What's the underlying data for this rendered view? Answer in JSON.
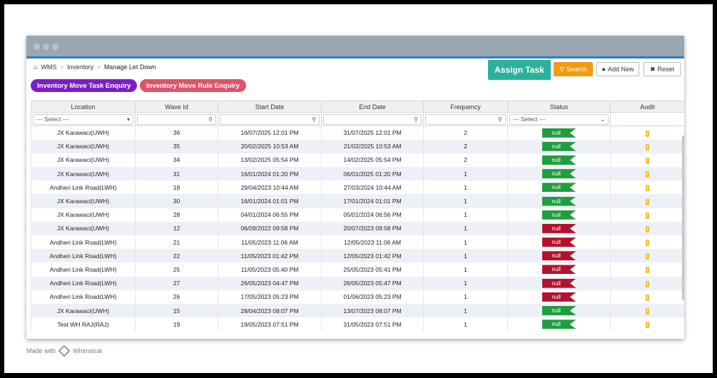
{
  "breadcrumb": {
    "root": "WMS",
    "section": "Inventory",
    "current": "Manage Let Down"
  },
  "tabs": {
    "move_task": "Inventory Move Task Enquiry",
    "move_rule": "Inventory Move Rule Enquiry"
  },
  "buttons": {
    "assign_task": "Assign Task",
    "search": "Search",
    "add_new": "Add New",
    "reset": "Reset"
  },
  "columns": [
    "Location",
    "Wave Id",
    "Start Date",
    "End Date",
    "Frequency",
    "Status",
    "Audit"
  ],
  "filters": {
    "location_select": "--- Select ---",
    "status_select": "--- Select ---"
  },
  "rows": [
    {
      "location": "JX Karawaci(UWH)",
      "wave": "36",
      "start": "16/07/2025 12:01 PM",
      "end": "31/07/2025 12:01 PM",
      "freq": "2",
      "status": "null",
      "color": "green"
    },
    {
      "location": "JX Karawaci(UWH)",
      "wave": "35",
      "start": "20/02/2025 10:53 AM",
      "end": "21/02/2025 10:53 AM",
      "freq": "2",
      "status": "null",
      "color": "green"
    },
    {
      "location": "JX Karawaci(UWH)",
      "wave": "34",
      "start": "13/02/2025 05:54 PM",
      "end": "14/02/2025 05:54 PM",
      "freq": "2",
      "status": "null",
      "color": "green"
    },
    {
      "location": "JX Karawaci(UWH)",
      "wave": "31",
      "start": "16/01/2024 01:20 PM",
      "end": "06/01/2025 01:20 PM",
      "freq": "1",
      "status": "null",
      "color": "green"
    },
    {
      "location": "Andheri Link Road(LWH)",
      "wave": "18",
      "start": "29/04/2023 10:44 AM",
      "end": "27/03/2024 10:44 AM",
      "freq": "1",
      "status": "null",
      "color": "green"
    },
    {
      "location": "JX Karawaci(UWH)",
      "wave": "30",
      "start": "16/01/2024 01:01 PM",
      "end": "17/01/2024 01:01 PM",
      "freq": "1",
      "status": "null",
      "color": "green"
    },
    {
      "location": "JX Karawaci(UWH)",
      "wave": "28",
      "start": "04/01/2024 06:55 PM",
      "end": "05/01/2024 06:56 PM",
      "freq": "1",
      "status": "null",
      "color": "green"
    },
    {
      "location": "JX Karawaci(UWH)",
      "wave": "12",
      "start": "06/09/2022 09:58 PM",
      "end": "20/07/2023 09:58 PM",
      "freq": "1",
      "status": "null",
      "color": "red"
    },
    {
      "location": "Andheri Link Road(LWH)",
      "wave": "21",
      "start": "11/05/2023 11:06 AM",
      "end": "12/05/2023 11:06 AM",
      "freq": "1",
      "status": "null",
      "color": "red"
    },
    {
      "location": "Andheri Link Road(LWH)",
      "wave": "22",
      "start": "11/05/2023 01:42 PM",
      "end": "12/05/2023 01:42 PM",
      "freq": "1",
      "status": "null",
      "color": "red"
    },
    {
      "location": "Andheri Link Road(LWH)",
      "wave": "25",
      "start": "11/05/2023 05:40 PM",
      "end": "25/05/2023 05:41 PM",
      "freq": "1",
      "status": "null",
      "color": "red"
    },
    {
      "location": "Andheri Link Road(LWH)",
      "wave": "27",
      "start": "26/05/2023 04:47 PM",
      "end": "26/05/2023 05:47 PM",
      "freq": "1",
      "status": "null",
      "color": "red"
    },
    {
      "location": "Andheri Link Road(LWH)",
      "wave": "26",
      "start": "17/05/2023 05:23 PM",
      "end": "01/06/2023 05:23 PM",
      "freq": "1",
      "status": "null",
      "color": "red"
    },
    {
      "location": "JX Karawaci(UWH)",
      "wave": "15",
      "start": "28/04/2023 08:07 PM",
      "end": "13/07/2023 08:07 PM",
      "freq": "1",
      "status": "null",
      "color": "green"
    },
    {
      "location": "Test WH RAJ(RAJ)",
      "wave": "19",
      "start": "19/05/2023 07:51 PM",
      "end": "31/05/2023 07:51 PM",
      "freq": "1",
      "status": "null",
      "color": "green"
    }
  ],
  "footer": {
    "made_with": "Made with",
    "brand": "Whimsical"
  },
  "icons": {
    "home": "home-icon",
    "search": "search-icon",
    "add": "plus-circle-icon",
    "reset": "close-icon",
    "audit": "info-icon"
  },
  "colors": {
    "assign": "#29b19b",
    "search": "#f39a11",
    "status_green": "#1e9e3e",
    "status_red": "#b3122b",
    "tab_a": "#7a1fc6",
    "tab_b": "#e0546a"
  }
}
